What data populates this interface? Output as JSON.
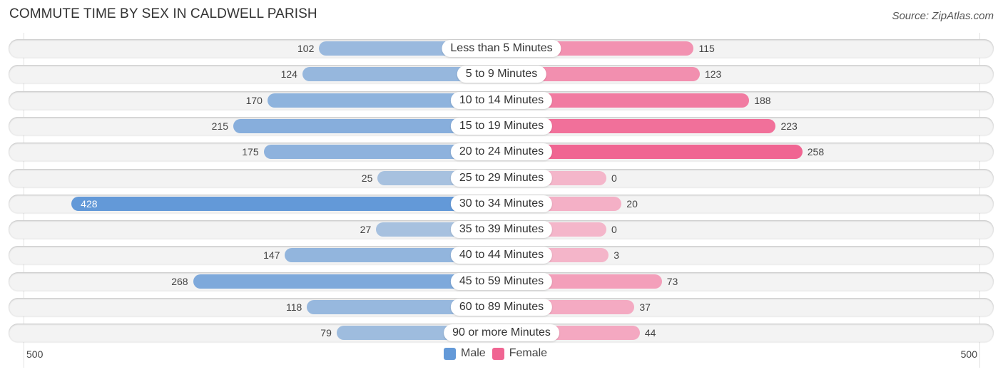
{
  "chart_data": {
    "type": "bar",
    "orientation": "horizontal-diverging",
    "title": "COMMUTE TIME BY SEX IN CALDWELL PARISH",
    "source": "Source: ZipAtlas.com",
    "categories": [
      "Less than 5 Minutes",
      "5 to 9 Minutes",
      "10 to 14 Minutes",
      "15 to 19 Minutes",
      "20 to 24 Minutes",
      "25 to 29 Minutes",
      "30 to 34 Minutes",
      "35 to 39 Minutes",
      "40 to 44 Minutes",
      "45 to 59 Minutes",
      "60 to 89 Minutes",
      "90 or more Minutes"
    ],
    "series": [
      {
        "name": "Male",
        "color": "#6399d8",
        "values": [
          102,
          124,
          170,
          215,
          175,
          25,
          428,
          27,
          147,
          268,
          118,
          79
        ]
      },
      {
        "name": "Female",
        "color": "#f06592",
        "values": [
          115,
          123,
          188,
          223,
          258,
          0,
          20,
          0,
          3,
          73,
          37,
          44
        ]
      }
    ],
    "axis": {
      "left_label": "500",
      "right_label": "500",
      "range": [
        0,
        500
      ]
    },
    "legend": {
      "placement": "bottom-center",
      "entries": [
        "Male",
        "Female"
      ]
    },
    "grid": false
  }
}
